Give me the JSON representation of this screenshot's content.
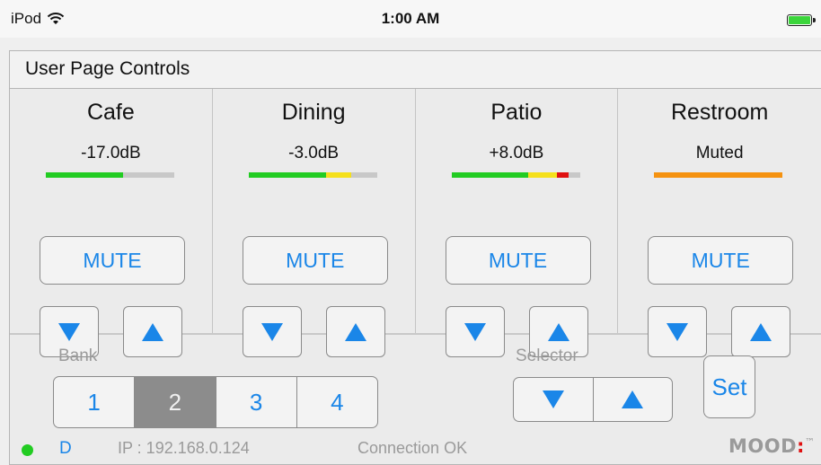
{
  "statusbar": {
    "device": "iPod",
    "time": "1:00 AM"
  },
  "panel": {
    "title": "User Page Controls"
  },
  "zones": [
    {
      "name": "Cafe",
      "level": "-17.0dB",
      "meter": {
        "green": 0.6,
        "yellow": 0,
        "red": 0,
        "orange": 0
      },
      "mute_label": "MUTE"
    },
    {
      "name": "Dining",
      "level": "-3.0dB",
      "meter": {
        "green": 0.6,
        "yellow": 0.2,
        "red": 0,
        "orange": 0
      },
      "mute_label": "MUTE"
    },
    {
      "name": "Patio",
      "level": "+8.0dB",
      "meter": {
        "green": 0.6,
        "yellow": 0.22,
        "red": 0.09,
        "orange": 0
      },
      "mute_label": "MUTE"
    },
    {
      "name": "Restroom",
      "level": "Muted",
      "meter": {
        "green": 0,
        "yellow": 0,
        "red": 0,
        "orange": 1.0
      },
      "mute_label": "MUTE"
    }
  ],
  "bank": {
    "label": "Bank",
    "options": [
      "1",
      "2",
      "3",
      "4"
    ],
    "selected": "2"
  },
  "selector": {
    "label": "Selector"
  },
  "set_label": "Set",
  "status": {
    "indicator_color": "#22cc22",
    "mode": "D",
    "ip": "IP : 192.168.0.124",
    "connection": "Connection OK"
  },
  "logo": {
    "text": "MOOD",
    "colon": ":",
    "tm": "™"
  },
  "colors": {
    "accent": "#1a86e8",
    "meter_green": "#22cc22",
    "meter_yellow": "#f5e01c",
    "meter_red": "#e01010",
    "meter_orange": "#f59210",
    "bank_active": "#8c8c8c"
  }
}
